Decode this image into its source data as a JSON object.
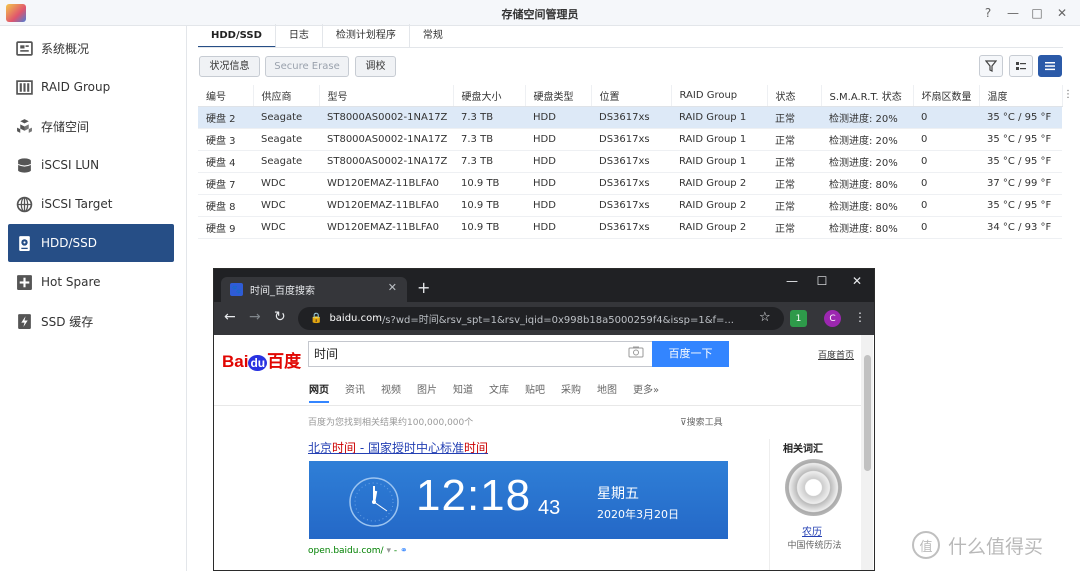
{
  "window": {
    "title": "存储空间管理员",
    "help": "?",
    "minimize": "—",
    "maximize": "□",
    "close": "✕"
  },
  "sidebar": {
    "items": [
      {
        "label": "系统概况",
        "icon": "overview-icon"
      },
      {
        "label": "RAID Group",
        "icon": "raid-icon"
      },
      {
        "label": "存储空间",
        "icon": "volume-icon"
      },
      {
        "label": "iSCSI LUN",
        "icon": "lun-icon"
      },
      {
        "label": "iSCSI Target",
        "icon": "target-icon"
      },
      {
        "label": "HDD/SSD",
        "icon": "disk-icon",
        "active": true
      },
      {
        "label": "Hot Spare",
        "icon": "plus-icon"
      },
      {
        "label": "SSD 缓存",
        "icon": "cache-icon"
      }
    ]
  },
  "tabs": [
    "HDD/SSD",
    "日志",
    "检测计划程序",
    "常规"
  ],
  "toolbar": {
    "status": "状况信息",
    "erase": "Secure Erase",
    "tune": "调校"
  },
  "table": {
    "headers": [
      "编号",
      "供应商",
      "型号",
      "硬盘大小",
      "硬盘类型",
      "位置",
      "RAID Group",
      "状态",
      "S.M.A.R.T. 状态",
      "坏扇区数量",
      "温度"
    ],
    "rows": [
      [
        "硬盘 2",
        "Seagate",
        "ST8000AS0002-1NA17Z",
        "7.3 TB",
        "HDD",
        "DS3617xs",
        "RAID Group 1",
        "正常",
        "检测进度: 20%",
        "0",
        "35 °C / 95 °F"
      ],
      [
        "硬盘 3",
        "Seagate",
        "ST8000AS0002-1NA17Z",
        "7.3 TB",
        "HDD",
        "DS3617xs",
        "RAID Group 1",
        "正常",
        "检测进度: 20%",
        "0",
        "35 °C / 95 °F"
      ],
      [
        "硬盘 4",
        "Seagate",
        "ST8000AS0002-1NA17Z",
        "7.3 TB",
        "HDD",
        "DS3617xs",
        "RAID Group 1",
        "正常",
        "检测进度: 20%",
        "0",
        "35 °C / 95 °F"
      ],
      [
        "硬盘 7",
        "WDC",
        "WD120EMAZ-11BLFA0",
        "10.9 TB",
        "HDD",
        "DS3617xs",
        "RAID Group 2",
        "正常",
        "检测进度: 80%",
        "0",
        "37 °C / 99 °F"
      ],
      [
        "硬盘 8",
        "WDC",
        "WD120EMAZ-11BLFA0",
        "10.9 TB",
        "HDD",
        "DS3617xs",
        "RAID Group 2",
        "正常",
        "检测进度: 80%",
        "0",
        "35 °C / 95 °F"
      ],
      [
        "硬盘 9",
        "WDC",
        "WD120EMAZ-11BLFA0",
        "10.9 TB",
        "HDD",
        "DS3617xs",
        "RAID Group 2",
        "正常",
        "检测进度: 80%",
        "0",
        "34 °C / 93 °F"
      ]
    ],
    "selected_row": 0
  },
  "browser": {
    "tab_title": "时间_百度搜索",
    "url_host": "baidu.com",
    "url_rest": "/s?wd=时间&rsv_spt=1&rsv_iqid=0x998b18a5000259f4&issp=1&f=...",
    "ext_badge": "1",
    "profile_letter": "C"
  },
  "baidu": {
    "logo_a": "Bai",
    "logo_du": "du",
    "logo_b": "百度",
    "query": "时间",
    "search_button": "百度一下",
    "home_link": "百度首页",
    "tabs": [
      "网页",
      "资讯",
      "视频",
      "图片",
      "知道",
      "文库",
      "贴吧",
      "采购",
      "地图",
      "更多»"
    ],
    "result_count": "百度为您找到相关结果约100,000,000个",
    "tools": "搜索工具",
    "result_title_parts": [
      "北京",
      "时间",
      " - 国家授时中心标准",
      "时间"
    ],
    "clock_time": "12:18",
    "clock_seconds": "43",
    "weekday": "星期五",
    "date": "2020年3月20日",
    "source": "open.baidu.com/",
    "related_title": "相关词汇",
    "related_link": "农历",
    "related_desc": "中国传统历法"
  },
  "watermark": {
    "symbol": "值",
    "text": "什么值得买"
  },
  "colors": {
    "accent": "#264e86",
    "ok_green": "#3a9c28",
    "baidu_blue": "#3385ff",
    "baidu_red": "#e10602"
  }
}
